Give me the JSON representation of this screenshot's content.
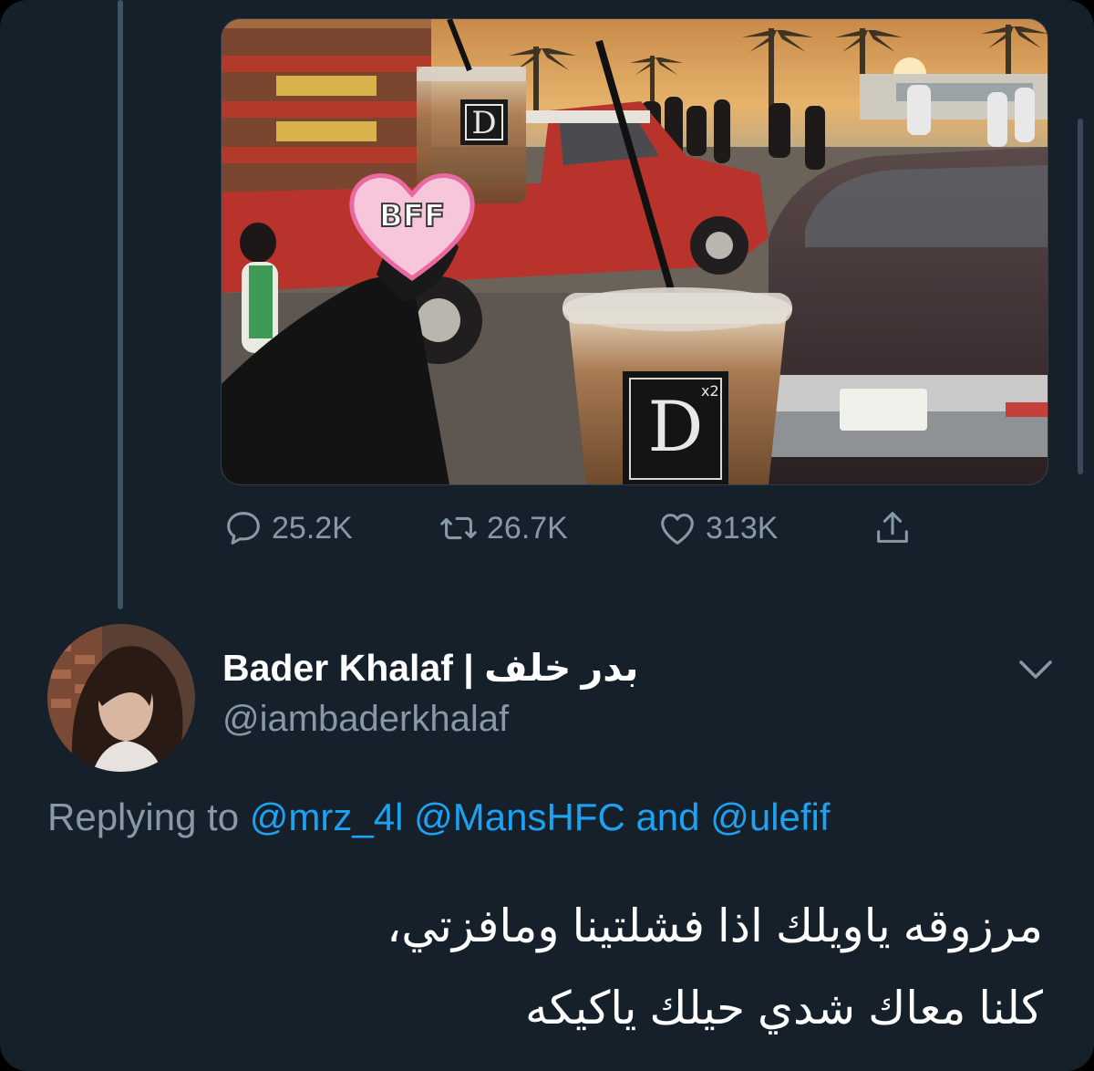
{
  "tweet_media": {
    "sticker_text": "BFF",
    "cup_logo": "D",
    "cup_logo_small": "x2"
  },
  "actions": {
    "reply_count": "25.2K",
    "retweet_count": "26.7K",
    "like_count": "313K"
  },
  "reply": {
    "display_name": "Bader Khalaf | بدر خلف",
    "handle": "@iambaderkhalaf",
    "replying_label": "Replying to",
    "mention_1": "@mrz_4l",
    "mention_2": "@MansHFC",
    "and_label": "and",
    "mention_3": "@ulefif",
    "text_line_1": "مرزوقه ياويلك اذا فشلتينا ومافزتي،",
    "text_line_2": "كلنا معاك شدي حيلك ياكيكه"
  },
  "icons": {
    "reply": "speech-bubble-icon",
    "retweet": "retweet-icon",
    "like": "heart-icon",
    "share": "share-icon",
    "more": "chevron-down-icon"
  },
  "colors": {
    "background": "#15202b",
    "link": "#1da1f2",
    "muted": "#8899a6",
    "text": "#ffffff"
  }
}
